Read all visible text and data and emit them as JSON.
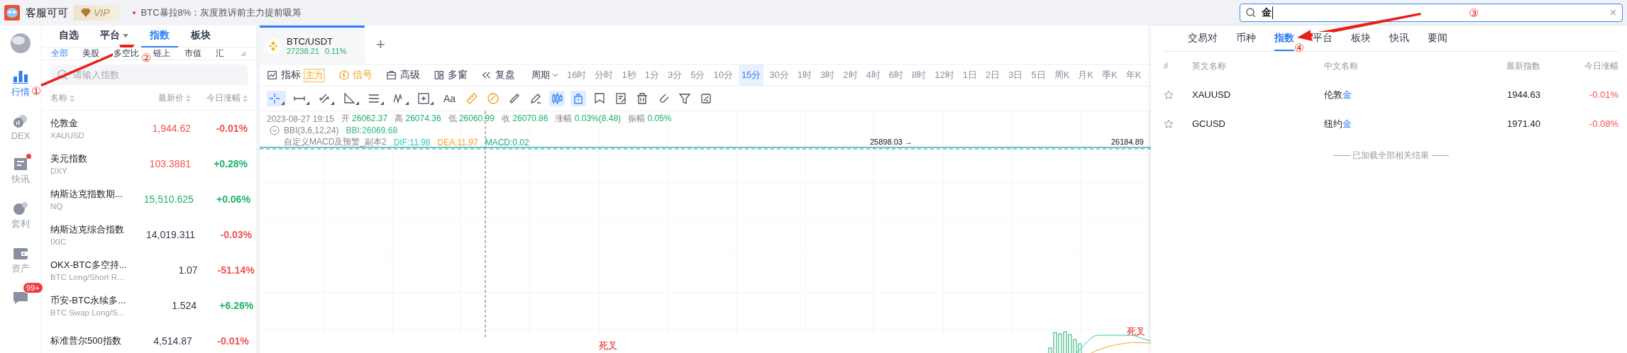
{
  "header": {
    "app_name": "客服可可",
    "vip": "VIP",
    "news": "BTC暴拉8%：灰度胜诉前主力提前吸筹"
  },
  "nav": [
    {
      "kind": "globe"
    },
    {
      "kind": "market",
      "label": "行情",
      "selected": true,
      "unread": false
    },
    {
      "kind": "dex",
      "label": "DEX",
      "selected": false,
      "unread": false
    },
    {
      "kind": "news",
      "label": "快讯",
      "selected": false,
      "unread": true
    },
    {
      "kind": "arbitrage",
      "label": "套利",
      "selected": false,
      "unread": false
    },
    {
      "kind": "assets",
      "label": "资产",
      "selected": false,
      "unread": false
    },
    {
      "kind": "chat",
      "badge": "99+"
    }
  ],
  "market_tabs": [
    {
      "label": "自选",
      "selected": false,
      "dropdown": false
    },
    {
      "label": "平台",
      "selected": false,
      "dropdown": true
    },
    {
      "label": "指数",
      "selected": true,
      "dropdown": false
    },
    {
      "label": "板块",
      "selected": false,
      "dropdown": false
    }
  ],
  "filters": [
    {
      "label": "全部",
      "selected": true
    },
    {
      "label": "美股",
      "selected": false
    },
    {
      "label": "多空比",
      "selected": false
    },
    {
      "label": "链上",
      "selected": false
    },
    {
      "label": "市值",
      "selected": false
    },
    {
      "label": "汇",
      "selected": false
    }
  ],
  "search": {
    "placeholder": "请输入指数"
  },
  "columns": [
    "名称",
    "最新价",
    "今日涨幅"
  ],
  "rows": [
    {
      "name": "伦敦金",
      "code": "XAUUSD",
      "price": {
        "text": "1,944.62",
        "color": "#ef5350"
      },
      "change": {
        "text": "-0.01%",
        "color": "#ef5350"
      }
    },
    {
      "name": "美元指数",
      "code": "DXY",
      "price": {
        "text": "103.3881",
        "color": "#ef5350"
      },
      "change": {
        "text": "+0.28%",
        "color": "#20b26c"
      }
    },
    {
      "name": "纳斯达克指数期...",
      "code": "NQ",
      "price": {
        "text": "15,510.625",
        "color": "#20b26c"
      },
      "change": {
        "text": "+0.06%",
        "color": "#20b26c"
      }
    },
    {
      "name": "纳斯达克综合指数",
      "code": "IXIC",
      "price": {
        "text": "14,019.311",
        "color": "#333a4d"
      },
      "change": {
        "text": "-0.03%",
        "color": "#ef5350"
      }
    },
    {
      "name": "OKX-BTC多空持...",
      "code": "BTC Long/Short R...",
      "price": {
        "text": "1.07",
        "color": "#333a4d"
      },
      "change": {
        "text": "-51.14%",
        "color": "#ef5350"
      }
    },
    {
      "name": "币安-BTC永续多...",
      "code": "BTC Swap Long/S...",
      "price": {
        "text": "1.524",
        "color": "#333a4d"
      },
      "change": {
        "text": "+6.26%",
        "color": "#20b26c"
      }
    },
    {
      "name": "标准普尔500指数",
      "price": {
        "text": "4,514.87",
        "color": "#333a4d"
      },
      "change": {
        "text": "-0.01%",
        "color": "#ef5350"
      }
    }
  ],
  "chart": {
    "symbol_tab": {
      "symbol": "BTC/USDT",
      "price": "27238.21",
      "change": "0.11%",
      "selected": true
    },
    "add_tab": "+",
    "toolbar": [
      {
        "kind": "indicator",
        "label": "指标",
        "tag": "主力"
      },
      {
        "kind": "signal",
        "label": "信号"
      },
      {
        "kind": "advanced",
        "label": "高级"
      },
      {
        "kind": "windows",
        "label": "多窗"
      },
      {
        "kind": "replay",
        "label": "复盘"
      }
    ],
    "period_menu": "周期",
    "periods": [
      {
        "label": "16时",
        "selected": false
      },
      {
        "label": "分时",
        "selected": false
      },
      {
        "label": "1秒",
        "selected": false
      },
      {
        "label": "1分",
        "selected": false
      },
      {
        "label": "3分",
        "selected": false
      },
      {
        "label": "5分",
        "selected": false
      },
      {
        "label": "10分",
        "selected": false
      },
      {
        "label": "15分",
        "selected": true
      },
      {
        "label": "30分",
        "selected": false
      },
      {
        "label": "1时",
        "selected": false
      },
      {
        "label": "3时",
        "selected": false
      },
      {
        "label": "2时",
        "selected": false
      },
      {
        "label": "4时",
        "selected": false
      },
      {
        "label": "6时",
        "selected": false
      },
      {
        "label": "8时",
        "selected": false
      },
      {
        "label": "12时",
        "selected": false
      },
      {
        "label": "1日",
        "selected": false
      },
      {
        "label": "2日",
        "selected": false
      },
      {
        "label": "3日",
        "selected": false
      },
      {
        "label": "5日",
        "selected": false
      },
      {
        "label": "周K",
        "selected": false
      },
      {
        "label": "月K",
        "selected": false
      },
      {
        "label": "季K",
        "selected": false
      },
      {
        "label": "年K",
        "selected": false
      }
    ],
    "text_tool": "Aa",
    "time": "2023-08-27 19:15",
    "ohlc": [
      {
        "label": "开",
        "value": "26062.37"
      },
      {
        "label": "高",
        "value": "26074.36"
      },
      {
        "label": "低",
        "value": "26060.99"
      },
      {
        "label": "收",
        "value": "26070.86"
      },
      {
        "label": "涨幅",
        "value": "0.03%(8.48)"
      },
      {
        "label": "振幅",
        "value": "0.05%"
      }
    ],
    "bbi": {
      "name": "BBI(3,6,12,24)",
      "values": [
        {
          "text": "BBI:26069.68",
          "color": "#2ebd85"
        }
      ]
    },
    "macd": {
      "name": "自定义MACD及预警_副本2",
      "values": [
        {
          "text": "DIF:11.98",
          "color": "#35c7b5"
        },
        {
          "text": "DEA:11.97",
          "color": "#f5a623"
        },
        {
          "text": "MACD:0.02",
          "color": "#20b26c"
        }
      ]
    },
    "low_mark": "25898.03 →",
    "high_mark": "26184.89",
    "signals": [
      "死叉",
      "死叉"
    ]
  },
  "search_panel": {
    "query": "金",
    "clear": "×",
    "tabs": [
      {
        "label": "交易对",
        "selected": false
      },
      {
        "label": "币种",
        "selected": false
      },
      {
        "label": "指数",
        "selected": true
      },
      {
        "label": "平台",
        "selected": false
      },
      {
        "label": "板块",
        "selected": false
      },
      {
        "label": "快讯",
        "selected": false
      },
      {
        "label": "要闻",
        "selected": false
      }
    ],
    "columns": [
      "#",
      "英文名称",
      "中文名称",
      "最新指数",
      "今日涨幅"
    ],
    "rows": [
      {
        "en": "XAUUSD",
        "cn_parts": [
          {
            "text": "伦敦",
            "match": false
          },
          {
            "text": "金",
            "match": true
          }
        ],
        "price": "1944.63",
        "change": {
          "text": "-0.01%",
          "color": "#ef5350"
        },
        "starred": false
      },
      {
        "en": "GCUSD",
        "cn_parts": [
          {
            "text": "纽约",
            "match": false
          },
          {
            "text": "金",
            "match": true
          }
        ],
        "price": "1971.40",
        "change": {
          "text": "-0.08%",
          "color": "#ef5350"
        },
        "starred": false
      }
    ],
    "footer": "—— 已加载全部相关结果 ——"
  },
  "annotations": [
    "①",
    "②",
    "③",
    "④"
  ]
}
